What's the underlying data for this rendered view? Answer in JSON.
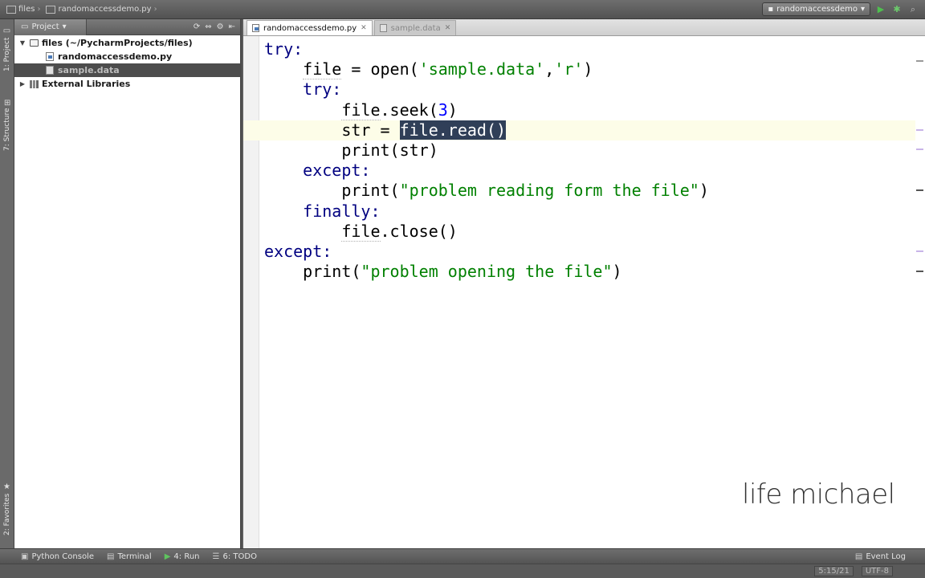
{
  "navbar": {
    "crumb_project": "files",
    "crumb_file": "randomaccessdemo.py",
    "run_config": "randomaccessdemo"
  },
  "left_strip": {
    "project_tab": "1: Project",
    "structure_tab": "7: Structure",
    "favorites_tab": "2: Favorites"
  },
  "project_panel": {
    "header_label": "Project",
    "tree": [
      {
        "label": "files (~/PycharmProjects/files)",
        "kind": "folder",
        "expanded": true
      },
      {
        "label": "randomaccessdemo.py",
        "kind": "python"
      },
      {
        "label": "sample.data",
        "kind": "data",
        "selected": true
      },
      {
        "label": "External Libraries",
        "kind": "library",
        "expanded": false
      }
    ]
  },
  "editor": {
    "tabs": [
      {
        "label": "randomaccessdemo.py",
        "active": true
      },
      {
        "label": "sample.data",
        "active": false
      }
    ],
    "code": {
      "l1_try": "try:",
      "l2_file": "file",
      "l2_eq": " = ",
      "l2_open": "open(",
      "l2_str1": "'sample.data'",
      "l2_comma": ",",
      "l2_str2": "'r'",
      "l2_close": ")",
      "l3_try": "try:",
      "l4_file": "file",
      "l4_seek": ".seek(",
      "l4_num": "3",
      "l4_close": ")",
      "l5_str": "str",
      "l5_eq": " = ",
      "l5_sel": "file.read()",
      "l6_print": "print(str)",
      "l7_except": "except:",
      "l8_print": "print(",
      "l8_str": "\"problem reading form the file\"",
      "l8_close": ")",
      "l9_finally": "finally:",
      "l10_file": "file",
      "l10_close": ".close()",
      "l11_except": "except:",
      "l12_print": "print(",
      "l12_str": "\"problem opening the file\"",
      "l12_close": ")"
    },
    "watermark": "life michael"
  },
  "bottom_bar": {
    "python_console": "Python Console",
    "terminal": "Terminal",
    "run": "4: Run",
    "todo": "6: TODO",
    "event_log": "Event Log"
  },
  "status_bar": {
    "position": "5:15/21",
    "encoding": "UTF-8"
  },
  "colors": {
    "keyword": "#000080",
    "string": "#008000",
    "number": "#0000ff",
    "selection": "#303f58",
    "current_line": "#fdfde8"
  }
}
